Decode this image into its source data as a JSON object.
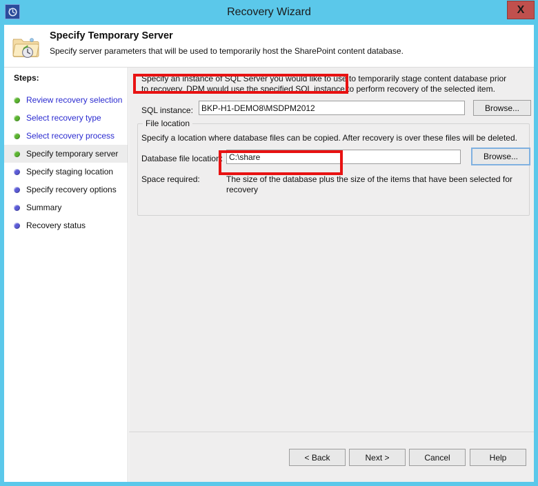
{
  "window": {
    "title": "Recovery Wizard",
    "app_icon": "recovery-clock-icon",
    "close_label": "X"
  },
  "header": {
    "icon": "folder-recovery-icon",
    "title": "Specify Temporary Server",
    "subtitle": "Specify server parameters that will be used to temporarily host the SharePoint content database."
  },
  "sidebar": {
    "heading": "Steps:",
    "items": [
      {
        "label": "Review recovery selection",
        "state": "done",
        "dot": "green",
        "link": true,
        "current": false
      },
      {
        "label": "Select recovery type",
        "state": "done",
        "dot": "green",
        "link": true,
        "current": false
      },
      {
        "label": "Select recovery process",
        "state": "done",
        "dot": "green",
        "link": true,
        "current": false
      },
      {
        "label": "Specify temporary server",
        "state": "current",
        "dot": "green",
        "link": false,
        "current": true
      },
      {
        "label": "Specify staging location",
        "state": "pending",
        "dot": "purple",
        "link": false,
        "current": false
      },
      {
        "label": "Specify recovery options",
        "state": "pending",
        "dot": "purple",
        "link": false,
        "current": false
      },
      {
        "label": "Summary",
        "state": "pending",
        "dot": "purple",
        "link": false,
        "current": false
      },
      {
        "label": "Recovery status",
        "state": "pending",
        "dot": "purple",
        "link": false,
        "current": false
      }
    ]
  },
  "content": {
    "intro": "Specify an instance of SQL Server you would like to use to temporarily stage content database prior to recovery. DPM would use the specified SQL instance to perform recovery of the selected item.",
    "sql_instance": {
      "label": "SQL instance:",
      "value": "BKP-H1-DEMO8\\MSDPM2012",
      "placeholder": "",
      "browse_label": "Browse..."
    },
    "file_location": {
      "legend": "File location",
      "description": "Specify a location where database files can be copied. After recovery is over these files will be deleted.",
      "db_location": {
        "label": "Database file location:",
        "value": "C:\\share",
        "placeholder": "",
        "browse_label": "Browse..."
      },
      "space_required": {
        "label": "Space required:",
        "value": "The size of the database plus the size of the items that have been selected for recovery"
      }
    }
  },
  "footer": {
    "back_label": "< Back",
    "next_label": "Next >",
    "cancel_label": "Cancel",
    "help_label": "Help"
  },
  "colors": {
    "title_bar": "#5bc8ea",
    "close_button": "#c0504d",
    "annotation": "#e81212",
    "step_done": "#5cb531",
    "step_pending": "#5b5bd6",
    "link_text": "#2a2ad0",
    "content_bg": "#efeeee"
  }
}
